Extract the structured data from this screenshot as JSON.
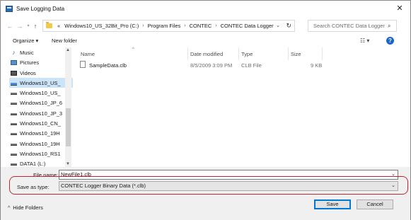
{
  "window": {
    "title": "Save Logging Data"
  },
  "address": {
    "crumbs": [
      "«",
      "Windows10_US_32Bit_Pro (C:)",
      "Program Files",
      "CONTEC",
      "CONTEC Data Logger"
    ],
    "separator": "›"
  },
  "search": {
    "placeholder": "Search CONTEC Data Logger"
  },
  "toolbar": {
    "organize_label": "Organize ▾",
    "new_folder_label": "New folder"
  },
  "sidebar": {
    "items": [
      {
        "label": "Music",
        "icon": "music-icon"
      },
      {
        "label": "Pictures",
        "icon": "pictures-icon"
      },
      {
        "label": "Videos",
        "icon": "videos-icon"
      },
      {
        "label": "Windows10_US_",
        "icon": "drive-icon",
        "selected": true
      },
      {
        "label": "Windows10_US_",
        "icon": "drive-icon"
      },
      {
        "label": "Windows10_JP_6",
        "icon": "drive-icon"
      },
      {
        "label": "Windows10_JP_3",
        "icon": "drive-icon"
      },
      {
        "label": "Windows10_CN_",
        "icon": "drive-icon"
      },
      {
        "label": "Windows10_19H",
        "icon": "drive-icon"
      },
      {
        "label": "Windows10_19H",
        "icon": "drive-icon"
      },
      {
        "label": "Windows10_RS1",
        "icon": "drive-icon"
      },
      {
        "label": "DATA1 (L:)",
        "icon": "drive-icon"
      }
    ]
  },
  "columns": {
    "name": "Name",
    "date": "Date modified",
    "type": "Type",
    "size": "Size"
  },
  "files": [
    {
      "name": "SampleData.clb",
      "date": "8/5/2009 3:09 PM",
      "type": "CLB File",
      "size": "9 KB"
    }
  ],
  "footer": {
    "file_name_label": "File name:",
    "file_name_value": "NewFile1.clb",
    "save_type_label": "Save as type:",
    "save_type_value": "CONTEC Logger Binary Data (*.clb)",
    "hide_folders_label": "Hide Folders",
    "save_label": "Save",
    "cancel_label": "Cancel"
  },
  "colors": {
    "selection": "#cce4f7",
    "highlight_ring": "#c0272d",
    "accent": "#0078d7"
  }
}
